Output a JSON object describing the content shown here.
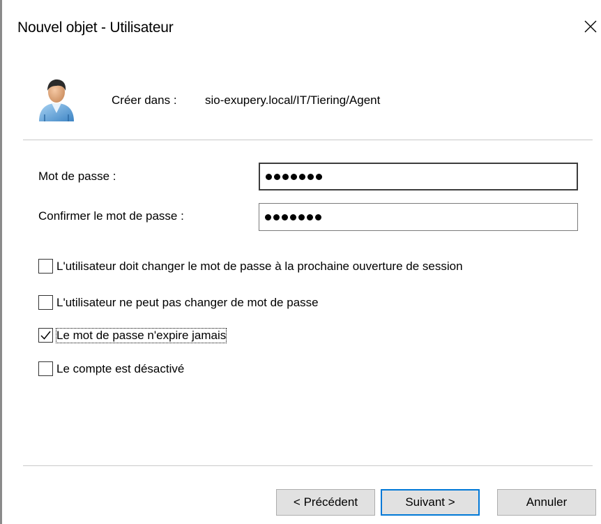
{
  "dialog": {
    "title": "Nouvel objet - Utilisateur",
    "close_glyph": "✕"
  },
  "header": {
    "icon": "user-icon",
    "create_label": "Créer dans :",
    "create_path": "sio-exupery.local/IT/Tiering/Agent"
  },
  "password": {
    "label": "Mot de passe :",
    "value": "•••••••"
  },
  "confirm": {
    "label": "Confirmer le mot de passe :",
    "value": "•••••••"
  },
  "options": [
    {
      "label": "L'utilisateur doit changer le mot de passe à la prochaine ouverture de session",
      "checked": false
    },
    {
      "label": "L'utilisateur ne peut pas changer de mot de passe",
      "checked": false
    },
    {
      "label": "Le mot de passe n'expire jamais",
      "checked": true
    },
    {
      "label": "Le compte est désactivé",
      "checked": false
    }
  ],
  "buttons": {
    "previous": "< Précédent",
    "next": "Suivant >",
    "cancel": "Annuler"
  },
  "colors": {
    "accent": "#0078d7",
    "button_bg": "#e1e1e1"
  }
}
